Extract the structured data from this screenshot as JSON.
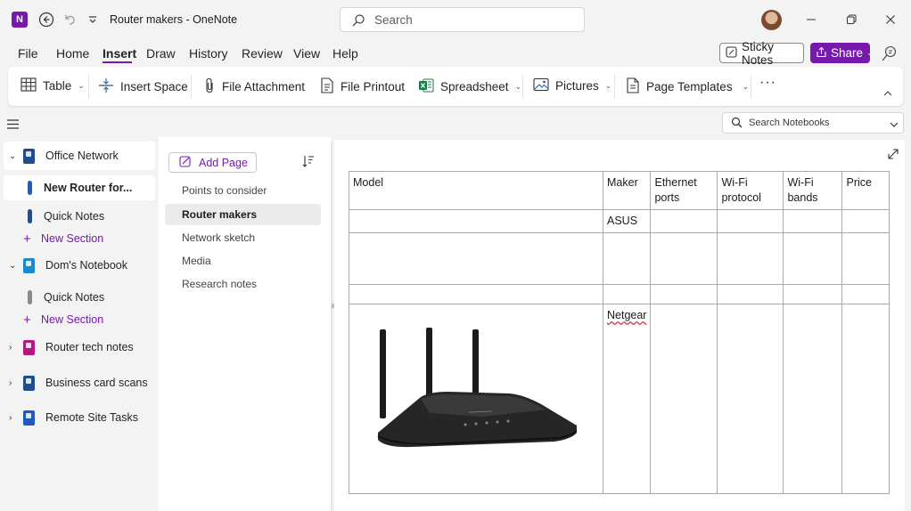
{
  "titlebar": {
    "app_icon_letter": "N",
    "title": "Router makers  -  OneNote",
    "search_placeholder": "Search"
  },
  "menu": {
    "items": [
      "File",
      "Home",
      "Insert",
      "Draw",
      "History",
      "Review",
      "View",
      "Help"
    ],
    "active": "Insert",
    "sticky_notes": "Sticky Notes",
    "share": "Share"
  },
  "ribbon": {
    "table": "Table",
    "insert_space": "Insert Space",
    "file_attachment": "File Attachment",
    "file_printout": "File Printout",
    "spreadsheet": "Spreadsheet",
    "pictures": "Pictures",
    "page_templates": "Page Templates",
    "more": "···"
  },
  "search_notebooks": {
    "placeholder": "Search Notebooks"
  },
  "notebooks": [
    {
      "name": "Office Network",
      "color": "#1e4e8c",
      "expanded": true
    },
    {
      "name": "New Router for...",
      "section_color": "#1e5bbd",
      "selected": true
    },
    {
      "name": "Quick Notes",
      "section_color": "#1e4e8c"
    },
    {
      "name": "New Section"
    },
    {
      "name": "Dom's Notebook",
      "color": "#1c8ad0",
      "expanded": true
    },
    {
      "name": "Quick Notes",
      "section_color": "#7f7f7f"
    },
    {
      "name": "New Section"
    },
    {
      "name": "Router tech notes",
      "color": "#b0197e"
    },
    {
      "name": "Business card scans",
      "color": "#1e4e8c"
    },
    {
      "name": "Remote Site Tasks",
      "color": "#1e5bbd"
    }
  ],
  "pages": {
    "add_page": "Add Page",
    "items": [
      "Points to consider",
      "Router makers",
      "Network sketch",
      "Media",
      "Research notes"
    ],
    "selected": "Router makers"
  },
  "table": {
    "headers": [
      "Model",
      "Maker",
      "Ethernet ports",
      "Wi-Fi protocol",
      "Wi-Fi bands",
      "Price"
    ],
    "rows": [
      [
        "",
        "ASUS",
        "",
        "",
        "",
        ""
      ],
      [
        "",
        "",
        "",
        "",
        "",
        ""
      ],
      [
        "",
        "",
        "",
        "",
        "",
        ""
      ],
      [
        "",
        "Netgear",
        "",
        "",
        "",
        ""
      ]
    ]
  }
}
